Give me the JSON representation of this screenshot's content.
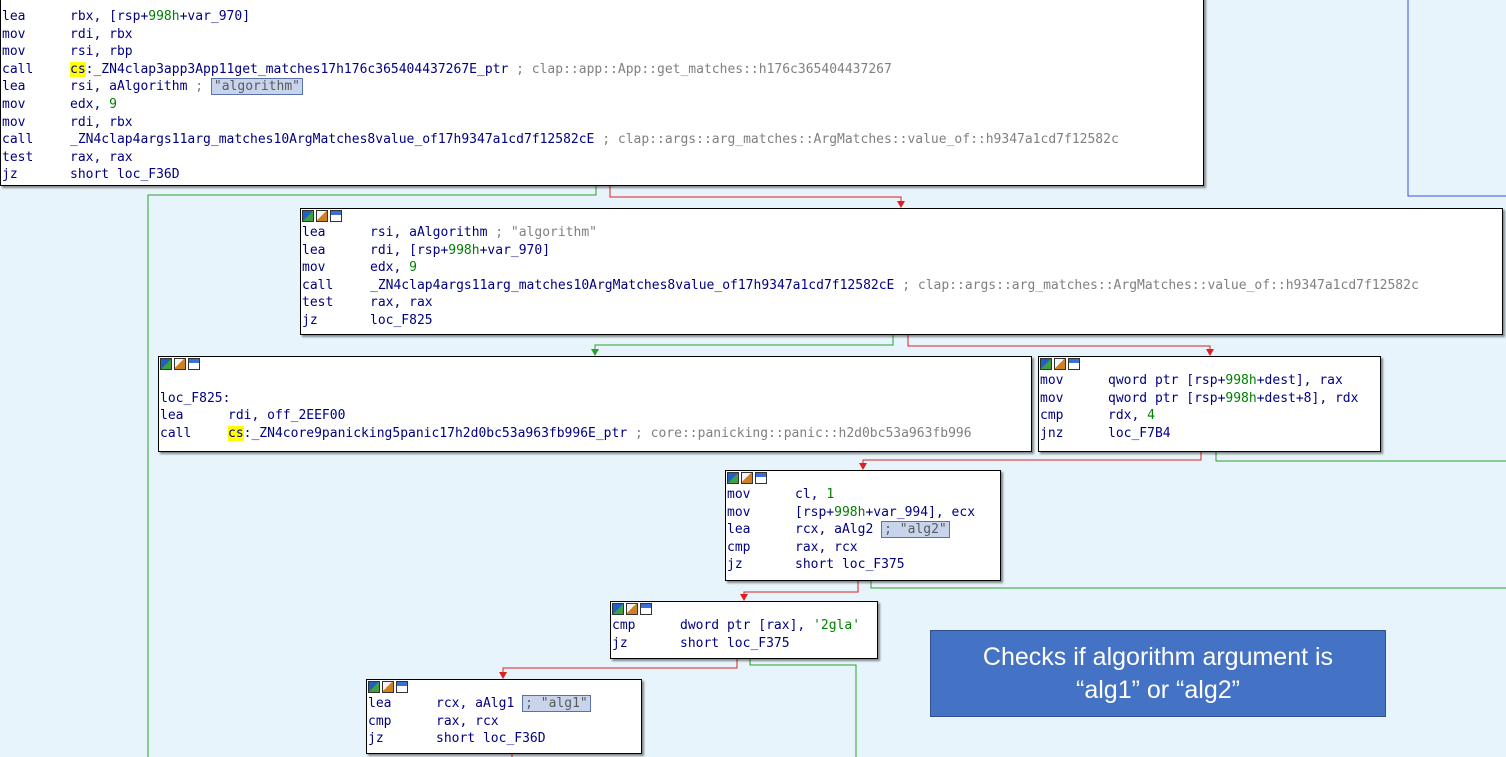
{
  "blocks": {
    "b1": {
      "lines": [
        {
          "mn": "lea",
          "pre": "rbx, [rsp+",
          "num": "998h",
          "post": "+var_970]",
          "cm": ""
        },
        {
          "mn": "mov",
          "pre": "rdi, rbx",
          "num": "",
          "post": "",
          "cm": ""
        },
        {
          "mn": "mov",
          "pre": "rsi, rbp",
          "num": "",
          "post": "",
          "cm": ""
        },
        {
          "mn": "call",
          "hl": "cs",
          "pre": ":_ZN4clap3app3App11get_matches17h176c365404437267E_ptr",
          "num": "",
          "post": "",
          "cm": " ; clap::app::App::get_matches::h176c365404437267"
        },
        {
          "mn": "lea",
          "pre": "rsi, aAlgorithm",
          "num": "",
          "post": "",
          "cm": " ; ",
          "sel": "\"algorithm\""
        },
        {
          "mn": "mov",
          "pre": "edx, ",
          "num": "9",
          "post": "",
          "cm": ""
        },
        {
          "mn": "mov",
          "pre": "rdi, rbx",
          "num": "",
          "post": "",
          "cm": ""
        },
        {
          "mn": "call",
          "pre": "_ZN4clap4args11arg_matches10ArgMatches8value_of17h9347a1cd7f12582cE",
          "num": "",
          "post": "",
          "cm": " ; clap::args::arg_matches::ArgMatches::value_of::h9347a1cd7f12582c"
        },
        {
          "mn": "test",
          "pre": "rax, rax",
          "num": "",
          "post": "",
          "cm": ""
        },
        {
          "mn": "jz",
          "pre": "short loc_F36D",
          "num": "",
          "post": "",
          "cm": ""
        }
      ]
    },
    "b2": {
      "lines": [
        {
          "mn": "lea",
          "pre": "rsi, aAlgorithm",
          "num": "",
          "post": "",
          "cm": " ; \"algorithm\""
        },
        {
          "mn": "lea",
          "pre": "rdi, [rsp+",
          "num": "998h",
          "post": "+var_970]",
          "cm": ""
        },
        {
          "mn": "mov",
          "pre": "edx, ",
          "num": "9",
          "post": "",
          "cm": ""
        },
        {
          "mn": "call",
          "pre": "_ZN4clap4args11arg_matches10ArgMatches8value_of17h9347a1cd7f12582cE",
          "num": "",
          "post": "",
          "cm": " ; clap::args::arg_matches::ArgMatches::value_of::h9347a1cd7f12582c"
        },
        {
          "mn": "test",
          "pre": "rax, rax",
          "num": "",
          "post": "",
          "cm": ""
        },
        {
          "mn": "jz",
          "pre": "loc_F825",
          "num": "",
          "post": "",
          "cm": ""
        }
      ]
    },
    "b3": {
      "label": "loc_F825:",
      "lines": [
        {
          "mn": "lea",
          "pre": "rdi, off_2EEF00",
          "num": "",
          "post": "",
          "cm": ""
        },
        {
          "mn": "call",
          "hl": "cs",
          "pre": ":_ZN4core9panicking5panic17h2d0bc53a963fb996E_ptr",
          "num": "",
          "post": "",
          "cm": " ; core::panicking::panic::h2d0bc53a963fb996"
        }
      ]
    },
    "b4": {
      "lines": [
        {
          "mn": "mov",
          "pre": "qword ptr [rsp+",
          "num": "998h",
          "post": "+dest], rax",
          "cm": ""
        },
        {
          "mn": "mov",
          "pre": "qword ptr [rsp+",
          "num": "998h",
          "post": "+dest+8], rdx",
          "cm": ""
        },
        {
          "mn": "cmp",
          "pre": "rdx, ",
          "num": "4",
          "post": "",
          "cm": ""
        },
        {
          "mn": "jnz",
          "pre": "loc_F7B4",
          "num": "",
          "post": "",
          "cm": ""
        }
      ]
    },
    "b5": {
      "lines": [
        {
          "mn": "mov",
          "pre": "cl, ",
          "num": "1",
          "post": "",
          "cm": ""
        },
        {
          "mn": "mov",
          "pre": "[rsp+",
          "num": "998h",
          "post": "+var_994], ecx",
          "cm": ""
        },
        {
          "mn": "lea",
          "pre": "rcx, aAlg2",
          "num": "",
          "post": "",
          "cm": "   ",
          "sel": "; \"alg2\""
        },
        {
          "mn": "cmp",
          "pre": "rax, rcx",
          "num": "",
          "post": "",
          "cm": ""
        },
        {
          "mn": "jz",
          "pre": "short loc_F375",
          "num": "",
          "post": "",
          "cm": ""
        }
      ]
    },
    "b6": {
      "lines": [
        {
          "mn": "cmp",
          "pre": "dword ptr [rax], ",
          "num": "'2gla'",
          "post": "",
          "cm": ""
        },
        {
          "mn": "jz",
          "pre": "short loc_F375",
          "num": "",
          "post": "",
          "cm": ""
        }
      ]
    },
    "b7": {
      "lines": [
        {
          "mn": "lea",
          "pre": "rcx, aAlg1",
          "num": "",
          "post": "",
          "cm": "   ",
          "sel": "; \"alg1\""
        },
        {
          "mn": "cmp",
          "pre": "rax, rcx",
          "num": "",
          "post": "",
          "cm": ""
        },
        {
          "mn": "jz",
          "pre": "short loc_F36D",
          "num": "",
          "post": "",
          "cm": ""
        }
      ]
    }
  },
  "callout": {
    "line1": "Checks if algorithm argument is",
    "line2": "“alg1” or “alg2”"
  },
  "colors": {
    "bg": "#e8f4fb",
    "edge_true": "#2ca02c",
    "edge_false": "#e02020",
    "edge_jump": "#3355cc",
    "callout": "#4472c4"
  },
  "icons": [
    "graph-color-icon",
    "edit-icon",
    "comment-icon"
  ]
}
